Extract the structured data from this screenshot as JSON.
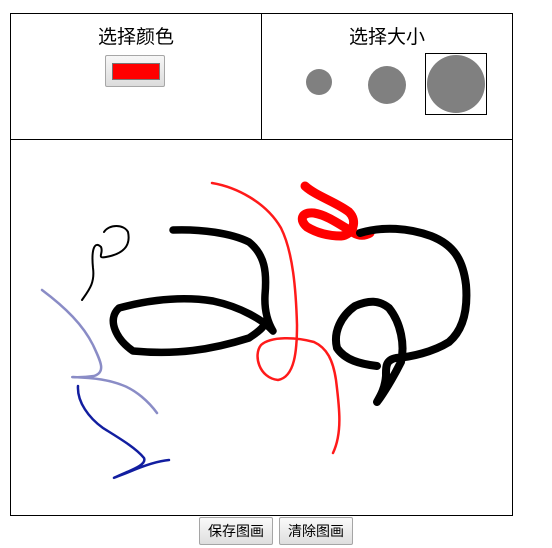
{
  "color_picker": {
    "title": "选择颜色",
    "selected_color": "#ff0000"
  },
  "size_picker": {
    "title": "选择大小",
    "options": [
      "small",
      "medium",
      "large"
    ],
    "selected": "large"
  },
  "actions": {
    "save_label": "保存图画",
    "clear_label": "清除图画"
  }
}
